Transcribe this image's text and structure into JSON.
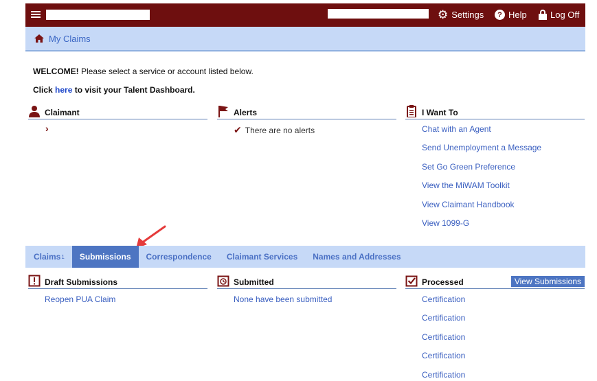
{
  "topbar": {
    "settings_label": "Settings",
    "help_label": "Help",
    "logoff_label": "Log Off",
    "background": "#6e0f0f"
  },
  "breadcrumb": {
    "label": "My Claims"
  },
  "welcome": {
    "bold": "WELCOME!",
    "text": " Please select a service or account listed below."
  },
  "dashboard": {
    "prefix": "Click ",
    "link": "here",
    "suffix": " to visit your Talent Dashboard."
  },
  "claimant": {
    "title": "Claimant",
    "chevron": "›"
  },
  "alerts": {
    "title": "Alerts",
    "message": "There are no alerts"
  },
  "iwant": {
    "title": "I Want To",
    "links": [
      "Chat with an Agent",
      "Send Unemployment a Message",
      "Set Go Green Preference",
      "View the MiWAM Toolkit",
      "View Claimant Handbook",
      "View 1099-G"
    ]
  },
  "tabs": {
    "claims": "Claims",
    "claims_badge": "1",
    "submissions": "Submissions",
    "correspondence": "Correspondence",
    "claimant_services": "Claimant Services",
    "names_addresses": "Names and Addresses",
    "accent": "#4d75c2"
  },
  "draft": {
    "title": "Draft Submissions",
    "items": [
      "Reopen PUA Claim"
    ]
  },
  "submitted": {
    "title": "Submitted",
    "items": [
      "None have been submitted"
    ]
  },
  "processed": {
    "title": "Processed",
    "button": "View Submissions",
    "items": [
      "Certification",
      "Certification",
      "Certification",
      "Certification",
      "Certification"
    ]
  }
}
